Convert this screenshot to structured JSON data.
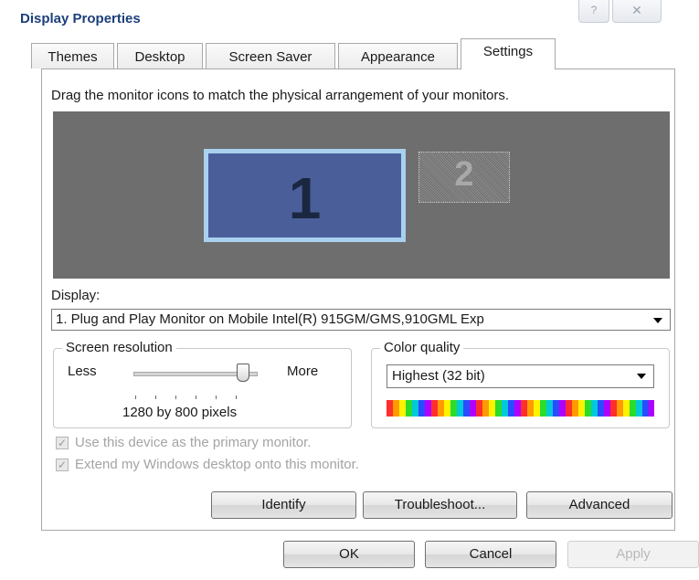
{
  "window": {
    "title": "Display Properties",
    "help_glyph": "?",
    "close_glyph": "✕"
  },
  "tabs": [
    {
      "label": "Themes",
      "active": false
    },
    {
      "label": "Desktop",
      "active": false
    },
    {
      "label": "Screen Saver",
      "active": false
    },
    {
      "label": "Appearance",
      "active": false
    },
    {
      "label": "Settings",
      "active": true
    }
  ],
  "settings": {
    "instructions": "Drag the monitor icons to match the physical arrangement of your monitors.",
    "monitors": [
      {
        "number": "1",
        "selected": true
      },
      {
        "number": "2",
        "selected": false
      }
    ],
    "display_label": "Display:",
    "display_value": "1. Plug and Play Monitor on Mobile Intel(R) 915GM/GMS,910GML Exp",
    "screen_resolution": {
      "legend": "Screen resolution",
      "less_label": "Less",
      "more_label": "More",
      "value_text": "1280 by 800 pixels",
      "slider_position_fraction": 0.9
    },
    "color_quality": {
      "legend": "Color quality",
      "selected": "Highest (32 bit)"
    },
    "checkboxes": {
      "primary": {
        "label": "Use this device as the primary monitor.",
        "checked": true,
        "enabled": false
      },
      "extend": {
        "label": "Extend my Windows desktop onto this monitor.",
        "checked": true,
        "enabled": false
      }
    },
    "buttons": {
      "identify": "Identify",
      "troubleshoot": "Troubleshoot...",
      "advanced": "Advanced"
    }
  },
  "dialog_buttons": {
    "ok": "OK",
    "cancel": "Cancel",
    "apply": "Apply"
  },
  "colors": {
    "title": "#1c3f7a",
    "arrangement_bg": "#6e6e6e",
    "monitor1_fill": "#4a5f9a",
    "monitor1_border": "#a9d0ee",
    "disabled_text": "#a4a4a4"
  }
}
